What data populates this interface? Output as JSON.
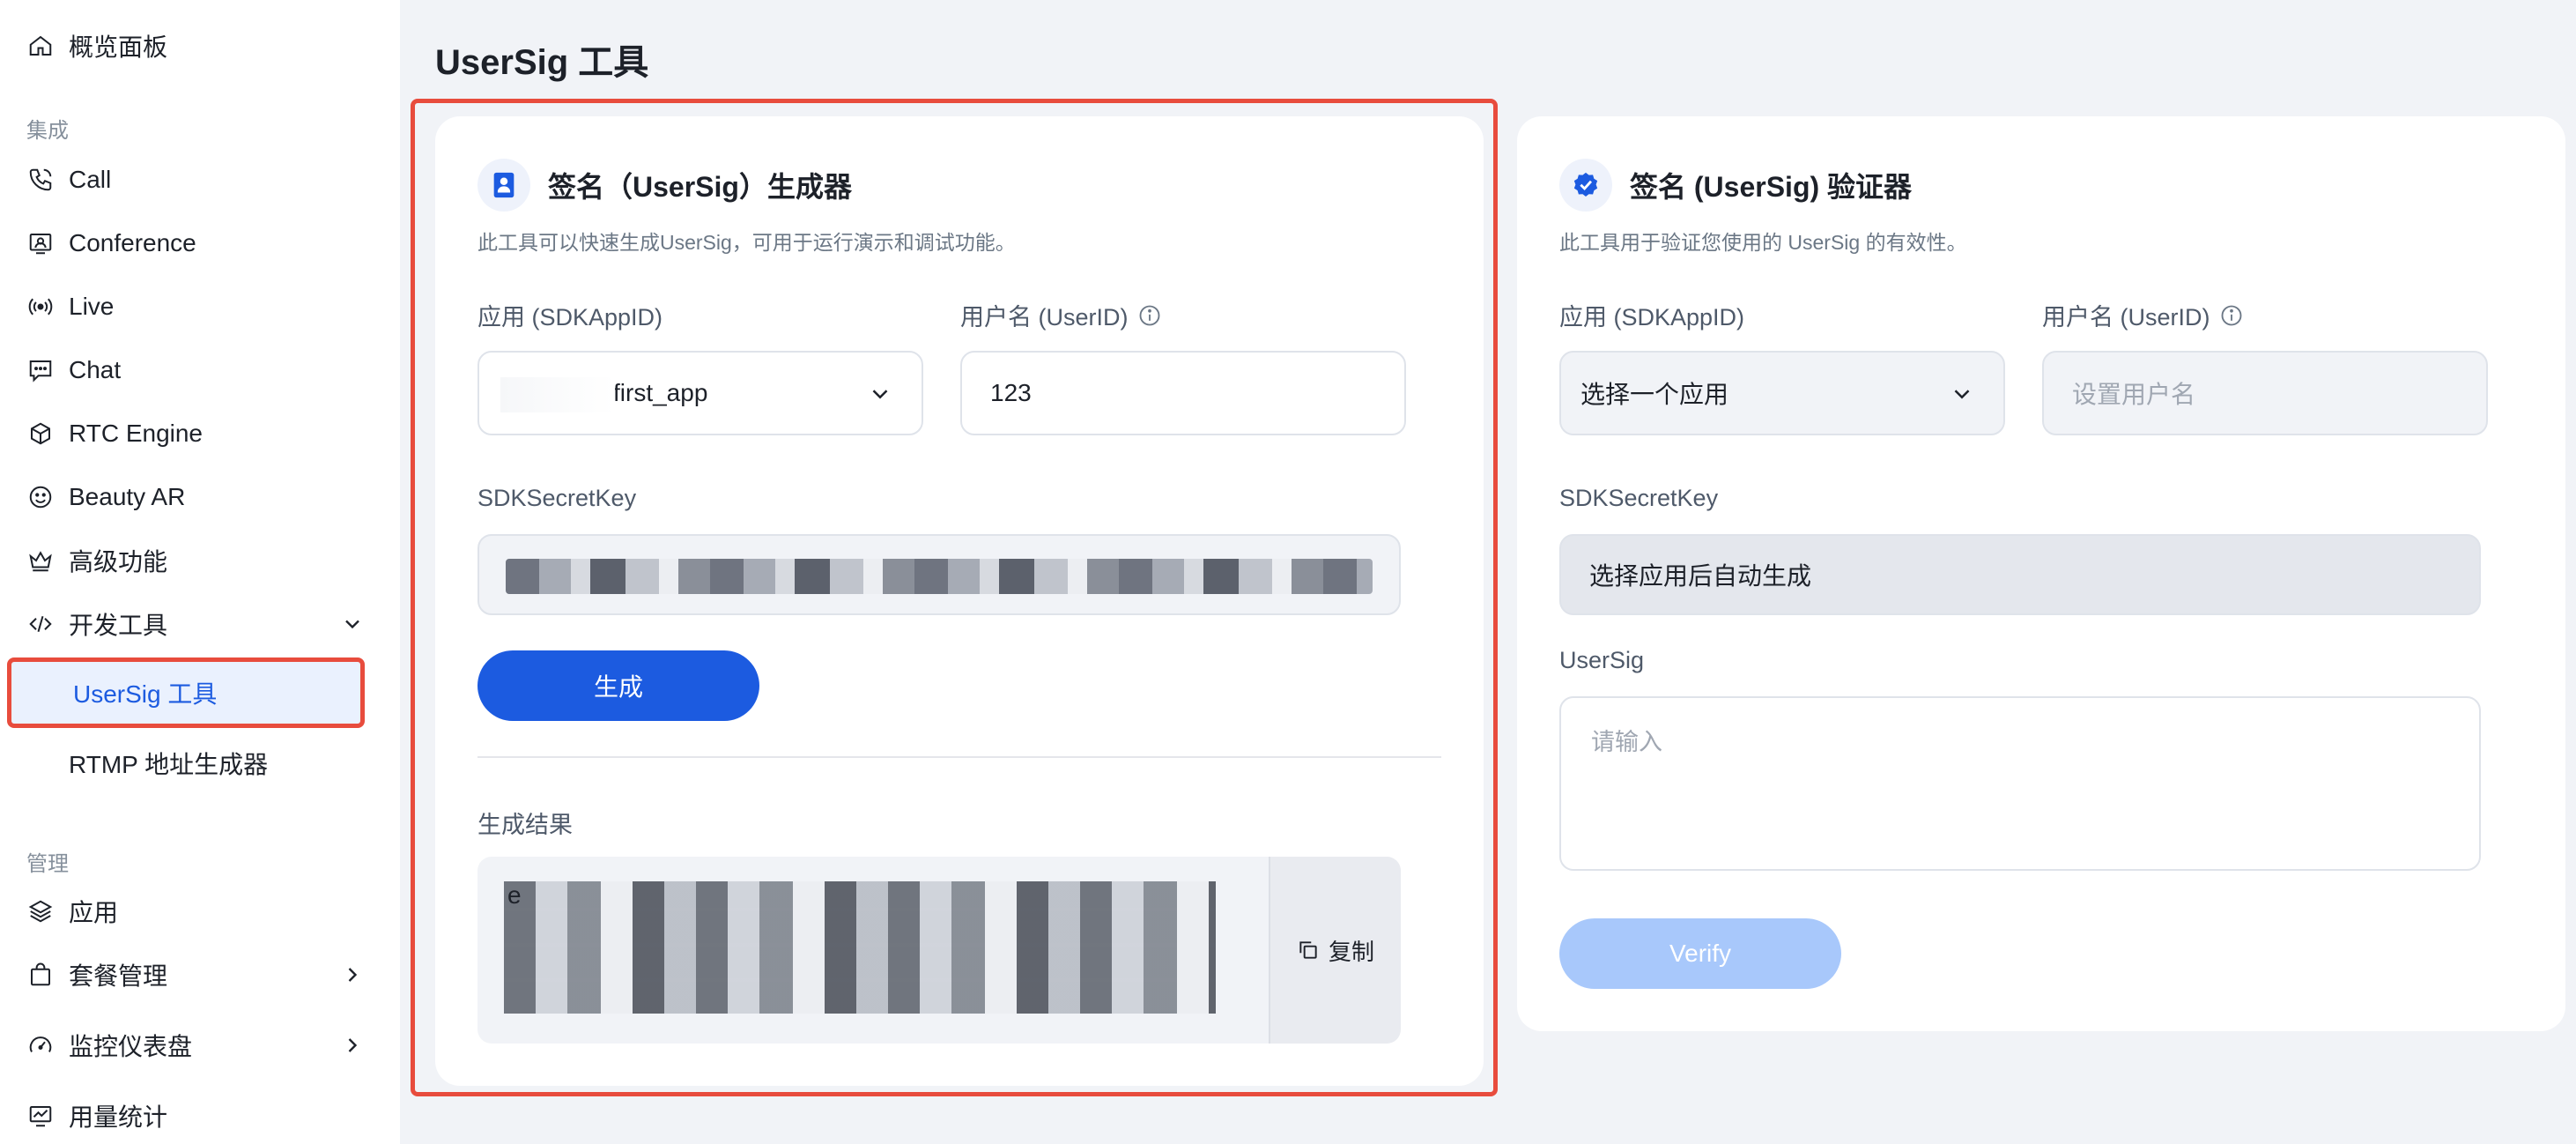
{
  "sidebar": {
    "overview": "概览面板",
    "section_integration": "集成",
    "items": [
      {
        "label": "Call"
      },
      {
        "label": "Conference"
      },
      {
        "label": "Live"
      },
      {
        "label": "Chat"
      },
      {
        "label": "RTC Engine"
      },
      {
        "label": "Beauty AR"
      },
      {
        "label": "高级功能"
      },
      {
        "label": "开发工具"
      }
    ],
    "dev_sub": [
      {
        "label": "UserSig 工具"
      },
      {
        "label": "RTMP 地址生成器"
      }
    ],
    "section_manage": "管理",
    "manage_items": [
      {
        "label": "应用"
      },
      {
        "label": "套餐管理"
      },
      {
        "label": "监控仪表盘"
      },
      {
        "label": "用量统计"
      }
    ]
  },
  "page": {
    "title": "UserSig 工具"
  },
  "generator": {
    "title": "签名（UserSig）生成器",
    "desc": "此工具可以快速生成UserSig，可用于运行演示和调试功能。",
    "app_label": "应用 (SDKAppID)",
    "app_value": "first_app",
    "user_label": "用户名 (UserID)",
    "user_value": "123",
    "secret_label": "SDKSecretKey",
    "generate_button": "生成",
    "result_label": "生成结果",
    "result_first_char": "e",
    "copy_button": "复制"
  },
  "verifier": {
    "title": "签名 (UserSig) 验证器",
    "desc": "此工具用于验证您使用的 UserSig 的有效性。",
    "app_label": "应用 (SDKAppID)",
    "app_placeholder": "选择一个应用",
    "user_label": "用户名 (UserID)",
    "user_placeholder": "设置用户名",
    "secret_label": "SDKSecretKey",
    "secret_value": "选择应用后自动生成",
    "usersig_label": "UserSig",
    "usersig_placeholder": "请输入",
    "verify_button": "Verify"
  },
  "colors": {
    "accent": "#1c5be0",
    "highlight": "#e84c3d",
    "disabled_button": "#a8c8fb"
  }
}
